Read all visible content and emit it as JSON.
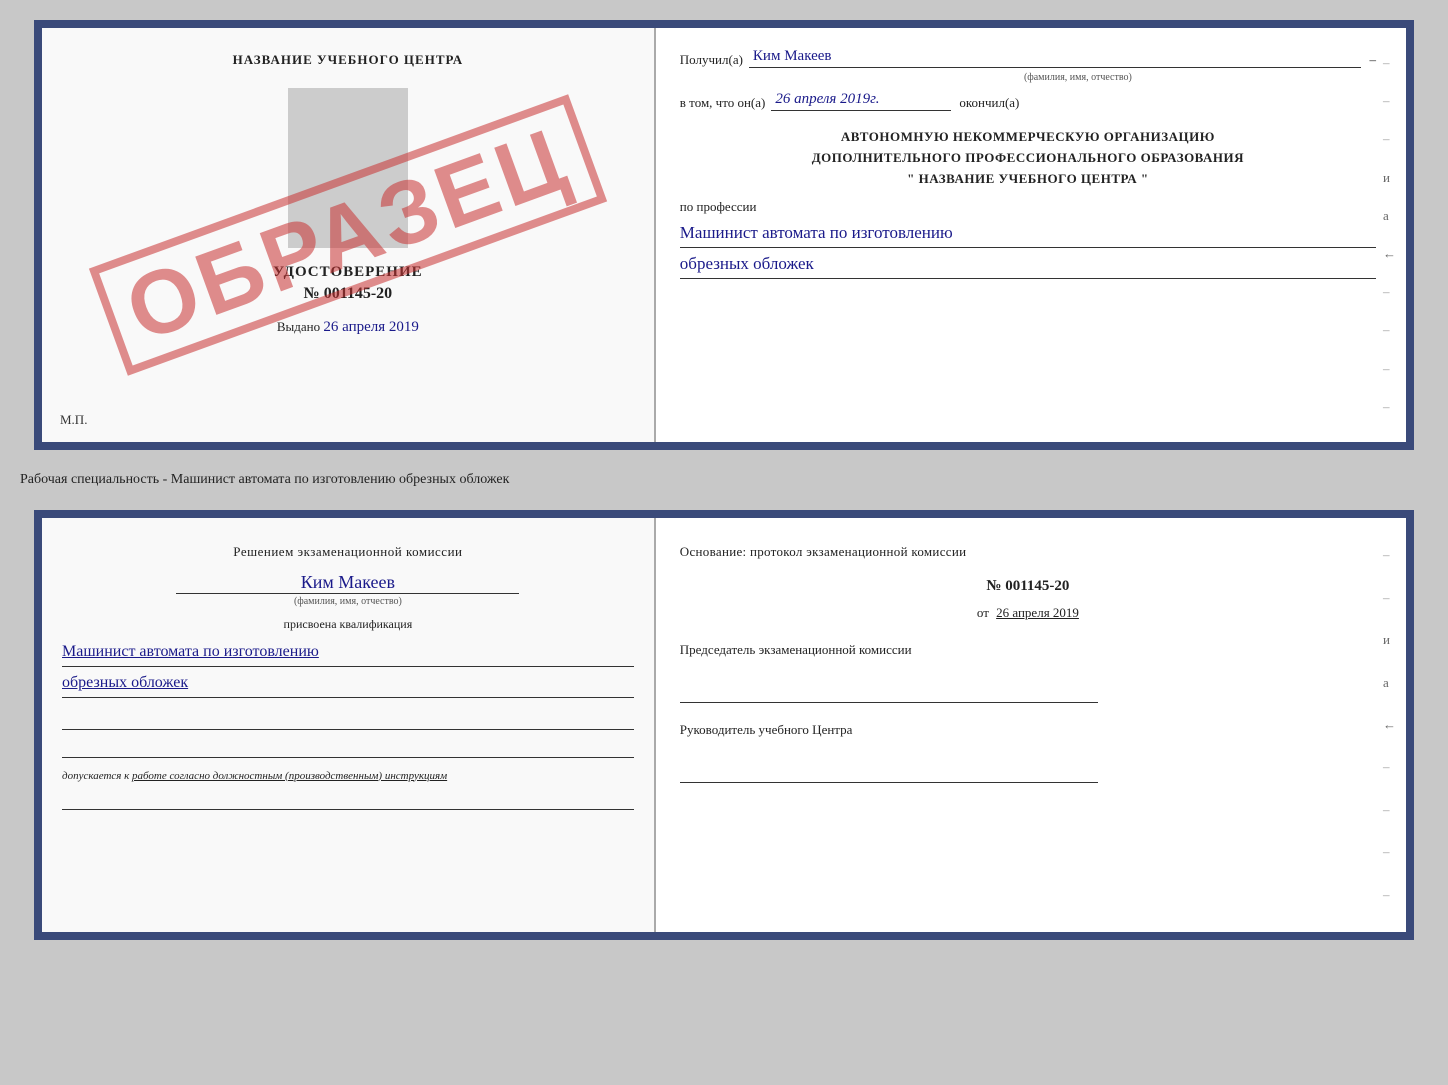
{
  "top_doc": {
    "left": {
      "center_title": "НАЗВАНИЕ УЧЕБНОГО ЦЕНТРА",
      "stamp_text": "ОБРАЗЕЦ",
      "cert_label": "УДОСТОВЕРЕНИЕ",
      "cert_number": "№ 001145-20",
      "issued_label": "Выдано",
      "issued_date": "26 апреля 2019",
      "mp_label": "М.П."
    },
    "right": {
      "received_label": "Получил(а)",
      "recipient_name": "Ким Макеев",
      "recipient_sub": "(фамилия, имя, отчество)",
      "date_label": "в том, что он(а)",
      "date_value": "26 апреля 2019г.",
      "finished_label": "окончил(а)",
      "org_line1": "АВТОНОМНУЮ НЕКОММЕРЧЕСКУЮ ОРГАНИЗАЦИЮ",
      "org_line2": "ДОПОЛНИТЕЛЬНОГО ПРОФЕССИОНАЛЬНОГО ОБРАЗОВАНИЯ",
      "org_line3": "\"   НАЗВАНИЕ УЧЕБНОГО ЦЕНТРА   \"",
      "profession_label": "по профессии",
      "profession_value1": "Машинист автомата по изготовлению",
      "profession_value2": "обрезных обложек"
    }
  },
  "description": "Рабочая специальность - Машинист автомата по изготовлению обрезных обложек",
  "bottom_doc": {
    "left": {
      "decision_title": "Решением экзаменационной комиссии",
      "name_value": "Ким Макеев",
      "name_sub": "(фамилия, имя, отчество)",
      "qualification_label": "присвоена квалификация",
      "qualification_value1": "Машинист автомата по изготовлению",
      "qualification_value2": "обрезных обложек",
      "admission_text": "допускается к",
      "admission_underline": "работе согласно должностным (производственным) инструкциям"
    },
    "right": {
      "basis_title": "Основание: протокол экзаменационной комиссии",
      "protocol_number": "№ 001145-20",
      "date_prefix": "от",
      "date_value": "26 апреля 2019",
      "chairman_label": "Председатель экзаменационной комиссии",
      "head_label": "Руководитель учебного Центра"
    }
  },
  "margin_items": [
    "-",
    "-",
    "-",
    "и",
    "а",
    "←",
    "-",
    "-",
    "-",
    "-"
  ],
  "margin_items_bottom": [
    "-",
    "-",
    "и",
    "а",
    "←",
    "-",
    "-",
    "-",
    "-"
  ]
}
